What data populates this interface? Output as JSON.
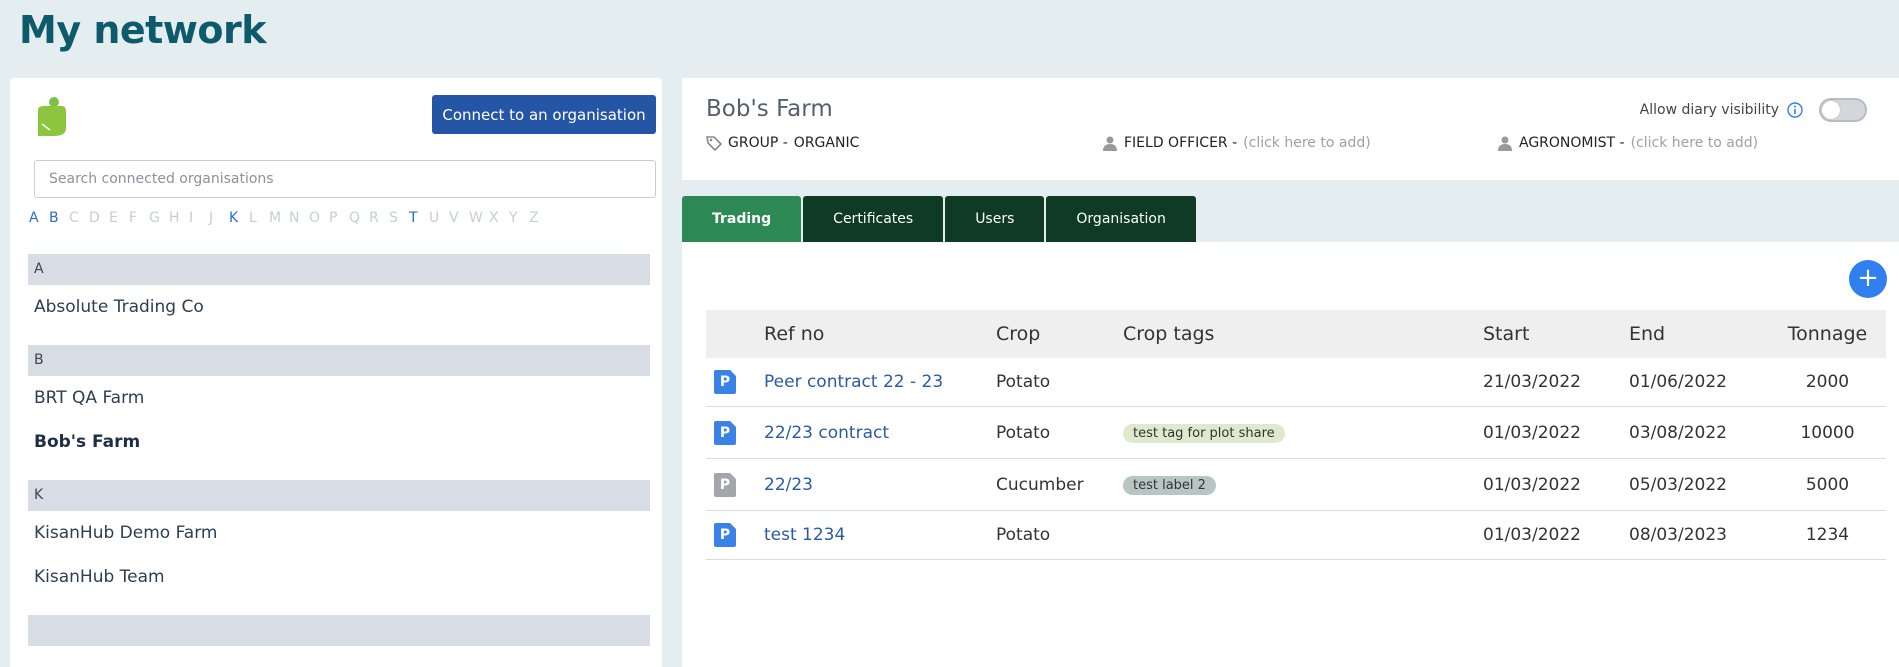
{
  "page": {
    "title": "My network"
  },
  "left": {
    "connect_label": "Connect to an organisation",
    "search_placeholder": "Search connected organisations",
    "alphabet": [
      {
        "letter": "A",
        "active": true
      },
      {
        "letter": "B",
        "active": true
      },
      {
        "letter": "C",
        "active": false
      },
      {
        "letter": "D",
        "active": false
      },
      {
        "letter": "E",
        "active": false
      },
      {
        "letter": "F",
        "active": false
      },
      {
        "letter": "G",
        "active": false
      },
      {
        "letter": "H",
        "active": false
      },
      {
        "letter": "I",
        "active": false
      },
      {
        "letter": "J",
        "active": false
      },
      {
        "letter": "K",
        "active": true
      },
      {
        "letter": "L",
        "active": false
      },
      {
        "letter": "M",
        "active": false
      },
      {
        "letter": "N",
        "active": false
      },
      {
        "letter": "O",
        "active": false
      },
      {
        "letter": "P",
        "active": false
      },
      {
        "letter": "Q",
        "active": false
      },
      {
        "letter": "R",
        "active": false
      },
      {
        "letter": "S",
        "active": false
      },
      {
        "letter": "T",
        "active": true
      },
      {
        "letter": "U",
        "active": false
      },
      {
        "letter": "V",
        "active": false
      },
      {
        "letter": "W",
        "active": false
      },
      {
        "letter": "X",
        "active": false
      },
      {
        "letter": "Y",
        "active": false
      },
      {
        "letter": "Z",
        "active": false
      }
    ],
    "groups": [
      {
        "letter": "A",
        "items": [
          {
            "name": "Absolute Trading Co",
            "selected": false
          }
        ]
      },
      {
        "letter": "B",
        "items": [
          {
            "name": "BRT QA Farm",
            "selected": false
          },
          {
            "name": "Bob's Farm",
            "selected": true
          }
        ]
      },
      {
        "letter": "K",
        "items": [
          {
            "name": "KisanHub Demo Farm",
            "selected": false
          },
          {
            "name": "KisanHub Team",
            "selected": false
          }
        ]
      }
    ]
  },
  "farm": {
    "name": "Bob's Farm",
    "group_label": "GROUP -",
    "group_value": "ORGANIC",
    "field_officer_label": "FIELD OFFICER -",
    "field_officer_hint": "(click here to add)",
    "agronomist_label": "AGRONOMIST -",
    "agronomist_hint": "(click here to add)",
    "diary_visibility_label": "Allow diary visibility",
    "diary_visibility_on": false
  },
  "tabs": [
    {
      "label": "Trading",
      "active": true
    },
    {
      "label": "Certificates",
      "active": false
    },
    {
      "label": "Users",
      "active": false
    },
    {
      "label": "Organisation",
      "active": false
    }
  ],
  "table": {
    "headers": [
      "Ref no",
      "Crop",
      "Crop tags",
      "Start",
      "End",
      "Tonnage"
    ],
    "rows": [
      {
        "icon": "P",
        "icon_color": "blue",
        "ref": "Peer contract 22 - 23",
        "crop": "Potato",
        "tag": "",
        "tag_style": "",
        "start": "21/03/2022",
        "end": "01/06/2022",
        "tonnage": "2000"
      },
      {
        "icon": "P",
        "icon_color": "blue",
        "ref": "22/23 contract",
        "crop": "Potato",
        "tag": "test tag for plot share",
        "tag_style": "green",
        "start": "01/03/2022",
        "end": "03/08/2022",
        "tonnage": "10000"
      },
      {
        "icon": "P",
        "icon_color": "grey",
        "ref": "22/23",
        "crop": "Cucumber",
        "tag": "test label 2",
        "tag_style": "grey",
        "start": "01/03/2022",
        "end": "05/03/2022",
        "tonnage": "5000"
      },
      {
        "icon": "P",
        "icon_color": "blue",
        "ref": "test 1234",
        "crop": "Potato",
        "tag": "",
        "tag_style": "",
        "start": "01/03/2022",
        "end": "08/03/2023",
        "tonnage": "1234"
      }
    ]
  },
  "colors": {
    "brand": "#0d5a6b",
    "primary_button": "#2456a5",
    "tab_active": "#2e8a55",
    "tab": "#0f3a23",
    "link": "#2a5aa8"
  }
}
